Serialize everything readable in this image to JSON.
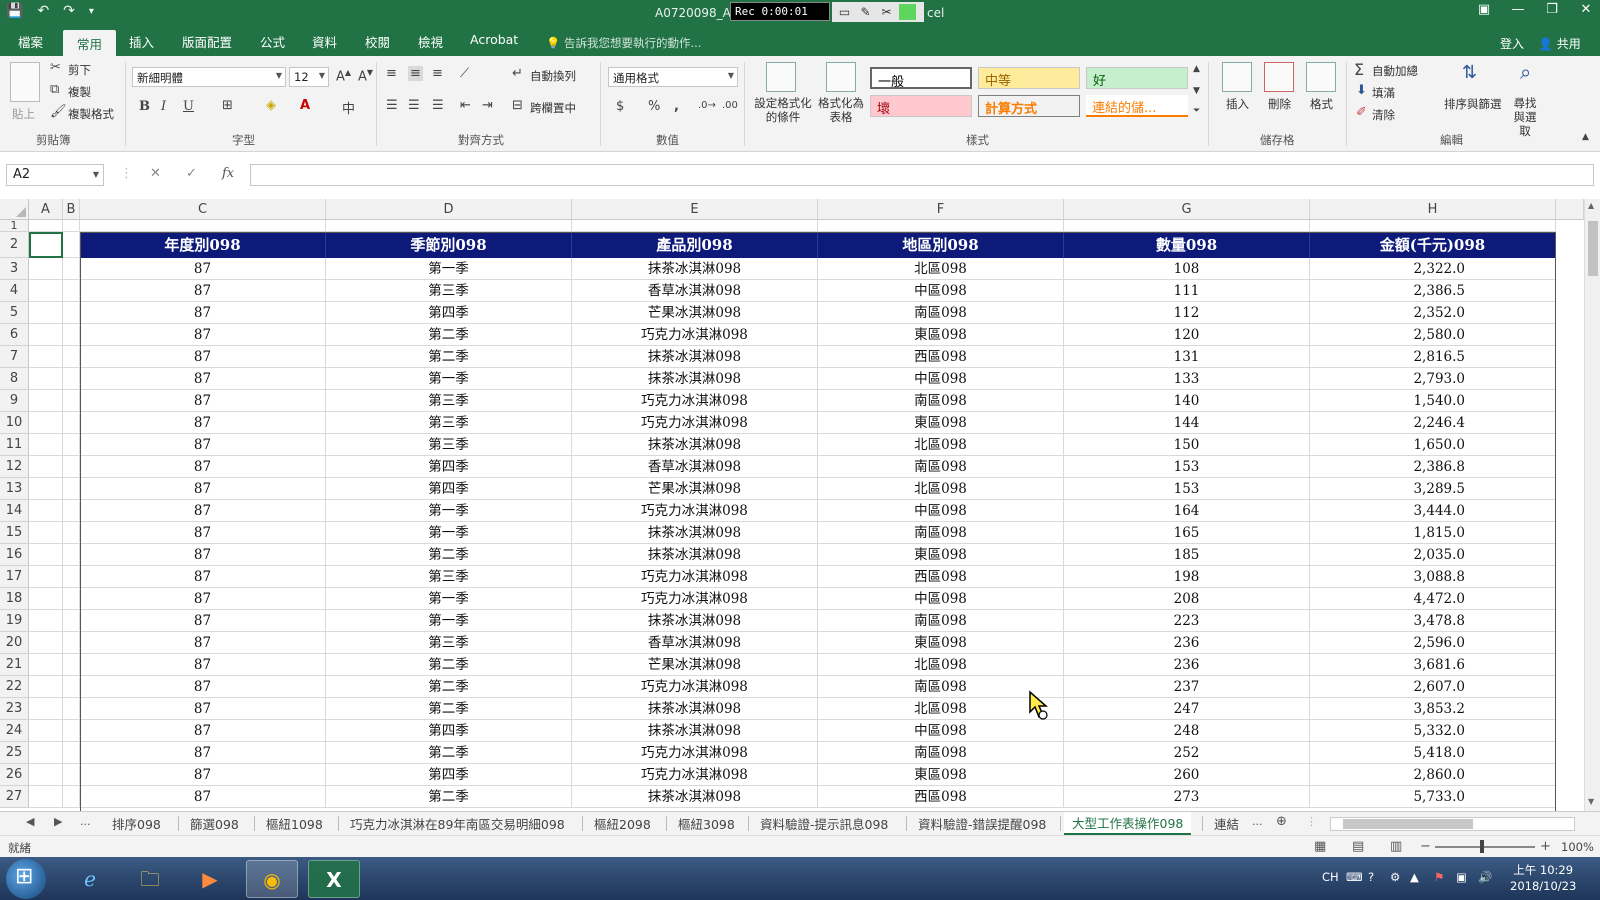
{
  "window": {
    "title_left": "A0720098_A",
    "title_right": "cel",
    "recorder_time": "Rec 0:00:01"
  },
  "ribbon_tabs": [
    "檔案",
    "常用",
    "插入",
    "版面配置",
    "公式",
    "資料",
    "校閱",
    "檢視",
    "Acrobat"
  ],
  "active_tab": "常用",
  "tell_me": "告訴我您想要執行的動作...",
  "account": {
    "signin": "登入",
    "share": "共用"
  },
  "clipboard": {
    "paste": "貼上",
    "cut": "剪下",
    "copy": "複製",
    "format_painter": "複製格式",
    "label": "剪貼簿"
  },
  "font": {
    "name": "新細明體",
    "size": "12",
    "bold": "B",
    "italic": "I",
    "underline": "U",
    "label": "字型"
  },
  "alignment": {
    "wrap": "自動換列",
    "merge": "跨欄置中",
    "label": "對齊方式"
  },
  "number": {
    "format": "通用格式",
    "currency": "$",
    "percent": "%",
    "comma": ",",
    "label": "數值"
  },
  "styles": {
    "conditional": "設定格式化的條件",
    "as_table": "格式化為表格",
    "cells": [
      {
        "name": "一般",
        "bg": "#ffffff",
        "fg": "#000000"
      },
      {
        "name": "中等",
        "bg": "#ffeb9c",
        "fg": "#9c6500"
      },
      {
        "name": "好",
        "bg": "#c6efce",
        "fg": "#006100"
      },
      {
        "name": "壞",
        "bg": "#ffc7ce",
        "fg": "#9c0006"
      },
      {
        "name": "計算方式",
        "bg": "#f2f2f2",
        "fg": "#fa7d00"
      },
      {
        "name": "連結的儲...",
        "bg": "#ffffff",
        "fg": "#fa7d00"
      }
    ],
    "label": "樣式"
  },
  "cells_group": {
    "insert": "插入",
    "delete": "刪除",
    "format": "格式",
    "label": "儲存格"
  },
  "editing": {
    "autosum": "自動加總",
    "fill": "填滿",
    "clear": "清除",
    "sort": "排序與篩選",
    "find": "尋找與選取",
    "label": "編輯"
  },
  "formula_bar": {
    "name_box": "A2",
    "cancel": "✕",
    "enter": "✓",
    "fx": "fx",
    "value": ""
  },
  "columns": [
    "A",
    "B",
    "C",
    "D",
    "E",
    "F",
    "G",
    "H"
  ],
  "table": {
    "headers": [
      "年度別098",
      "季節別098",
      "產品別098",
      "地區別098",
      "數量098",
      "金額(千元)098"
    ],
    "rows": [
      [
        "87",
        "第一季",
        "抹茶冰淇淋098",
        "北區098",
        "108",
        "2,322.0"
      ],
      [
        "87",
        "第三季",
        "香草冰淇淋098",
        "中區098",
        "111",
        "2,386.5"
      ],
      [
        "87",
        "第四季",
        "芒果冰淇淋098",
        "南區098",
        "112",
        "2,352.0"
      ],
      [
        "87",
        "第二季",
        "巧克力冰淇淋098",
        "東區098",
        "120",
        "2,580.0"
      ],
      [
        "87",
        "第二季",
        "抹茶冰淇淋098",
        "西區098",
        "131",
        "2,816.5"
      ],
      [
        "87",
        "第一季",
        "抹茶冰淇淋098",
        "中區098",
        "133",
        "2,793.0"
      ],
      [
        "87",
        "第三季",
        "巧克力冰淇淋098",
        "南區098",
        "140",
        "1,540.0"
      ],
      [
        "87",
        "第三季",
        "巧克力冰淇淋098",
        "東區098",
        "144",
        "2,246.4"
      ],
      [
        "87",
        "第三季",
        "抹茶冰淇淋098",
        "北區098",
        "150",
        "1,650.0"
      ],
      [
        "87",
        "第四季",
        "香草冰淇淋098",
        "南區098",
        "153",
        "2,386.8"
      ],
      [
        "87",
        "第四季",
        "芒果冰淇淋098",
        "北區098",
        "153",
        "3,289.5"
      ],
      [
        "87",
        "第一季",
        "巧克力冰淇淋098",
        "中區098",
        "164",
        "3,444.0"
      ],
      [
        "87",
        "第一季",
        "抹茶冰淇淋098",
        "南區098",
        "165",
        "1,815.0"
      ],
      [
        "87",
        "第二季",
        "抹茶冰淇淋098",
        "東區098",
        "185",
        "2,035.0"
      ],
      [
        "87",
        "第三季",
        "巧克力冰淇淋098",
        "西區098",
        "198",
        "3,088.8"
      ],
      [
        "87",
        "第一季",
        "巧克力冰淇淋098",
        "中區098",
        "208",
        "4,472.0"
      ],
      [
        "87",
        "第一季",
        "抹茶冰淇淋098",
        "南區098",
        "223",
        "3,478.8"
      ],
      [
        "87",
        "第三季",
        "香草冰淇淋098",
        "東區098",
        "236",
        "2,596.0"
      ],
      [
        "87",
        "第二季",
        "芒果冰淇淋098",
        "北區098",
        "236",
        "3,681.6"
      ],
      [
        "87",
        "第二季",
        "巧克力冰淇淋098",
        "南區098",
        "237",
        "2,607.0"
      ],
      [
        "87",
        "第二季",
        "抹茶冰淇淋098",
        "北區098",
        "247",
        "3,853.2"
      ],
      [
        "87",
        "第四季",
        "抹茶冰淇淋098",
        "中區098",
        "248",
        "5,332.0"
      ],
      [
        "87",
        "第二季",
        "巧克力冰淇淋098",
        "南區098",
        "252",
        "5,418.0"
      ],
      [
        "87",
        "第四季",
        "巧克力冰淇淋098",
        "東區098",
        "260",
        "2,860.0"
      ],
      [
        "87",
        "第二季",
        "抹茶冰淇淋098",
        "西區098",
        "273",
        "5,733.0"
      ]
    ]
  },
  "row_numbers": [
    "1",
    "2",
    "3",
    "4",
    "5",
    "6",
    "7",
    "8",
    "9",
    "10",
    "11",
    "12",
    "13",
    "14",
    "15",
    "16",
    "17",
    "18",
    "19",
    "20",
    "21",
    "22",
    "23",
    "24",
    "25",
    "26",
    "27"
  ],
  "sheet_tabs": [
    "排序098",
    "篩選098",
    "樞紐1098",
    "巧克力冰淇淋在89年南區交易明細098",
    "樞紐2098",
    "樞紐3098",
    "資料驗證-提示訊息098",
    "資料驗證-錯誤提醒098",
    "大型工作表操作098",
    "連結"
  ],
  "active_sheet": "大型工作表操作098",
  "sheet_more": "...",
  "status": {
    "ready": "就緒",
    "zoom": "100%"
  },
  "taskbar": {
    "ime": "CH",
    "time": "上午 10:29",
    "date": "2018/10/23"
  },
  "colors": {
    "excel_green": "#217346",
    "table_header_bg": "#0d1a7a"
  }
}
